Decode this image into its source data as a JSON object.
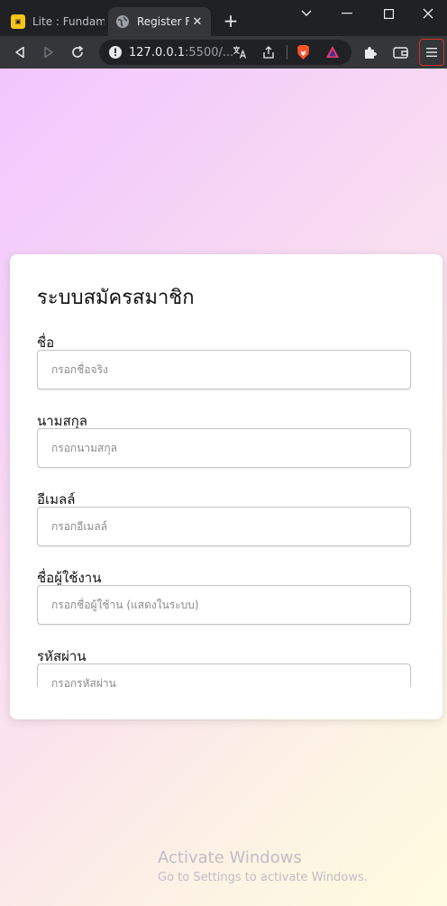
{
  "browser": {
    "tabs": [
      {
        "title": "Lite : Fundame",
        "active": false
      },
      {
        "title": "Register Fo",
        "active": true
      }
    ],
    "new_tab_symbol": "+",
    "close_symbol": "✕",
    "url_host": "127.0.0.1",
    "url_rest": ":5500/..."
  },
  "form": {
    "title": "ระบบสมัครสมาชิก",
    "fields": [
      {
        "label": "ชื่อ",
        "placeholder": "กรอกชื่อจริง"
      },
      {
        "label": "นามสกุล",
        "placeholder": "กรอกนามสกุล"
      },
      {
        "label": "อีเมลล์",
        "placeholder": "กรอกอีเมลล์"
      },
      {
        "label": "ชื่อผู้ใช้งาน",
        "placeholder": "กรอกชื่อผู้ใช้าน (แสดงในระบบ)"
      },
      {
        "label": "รหัสผ่าน",
        "placeholder": "กรอกรหัสผ่าน"
      }
    ]
  },
  "watermark": {
    "title": "Activate Windows",
    "subtitle": "Go to Settings to activate Windows."
  },
  "colors": {
    "accent_red": "#d93025",
    "brave_orange": "#fb542b",
    "gradient_start": "#f1c6ff",
    "gradient_end": "#fefce0"
  }
}
